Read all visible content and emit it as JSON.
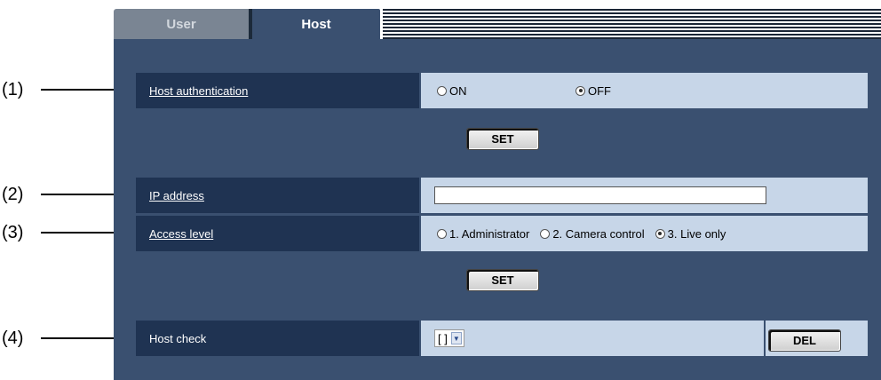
{
  "callouts": [
    "(1)",
    "(2)",
    "(3)",
    "(4)"
  ],
  "tabs": [
    {
      "label": "User"
    },
    {
      "label": "Host"
    }
  ],
  "host_auth": {
    "label": "Host authentication",
    "options": [
      "ON",
      "OFF"
    ],
    "selected": "OFF"
  },
  "set_label": "SET",
  "ip_address": {
    "label": "IP address",
    "value": "",
    "placeholder": ""
  },
  "access_level": {
    "label": "Access level",
    "options": [
      "1. Administrator",
      "2. Camera control",
      "3. Live only"
    ],
    "selected": "3. Live only"
  },
  "host_check": {
    "label": "Host check",
    "selected": "[ ]",
    "del_label": "DEL"
  }
}
